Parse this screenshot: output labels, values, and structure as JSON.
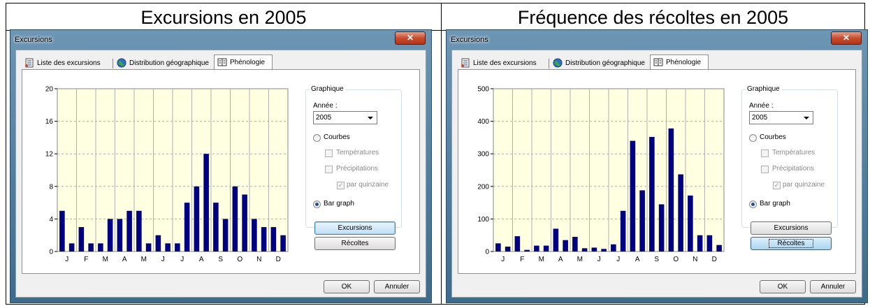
{
  "panels": [
    {
      "heading": "Excursions en 2005",
      "window_title": "Excursions",
      "tabs": [
        {
          "label": "Liste des excursions",
          "icon": "list-icon",
          "active": false
        },
        {
          "label": "Distribution géographique",
          "icon": "globe-icon",
          "active": false
        },
        {
          "label": "Phénologie",
          "icon": "book-icon",
          "active": true
        }
      ],
      "group_title": "Graphique",
      "annee_label": "Année :",
      "annee_value": "2005",
      "radio_courbes": "Courbes",
      "chk_temperatures": "Températures",
      "chk_precipitations": "Précipitations",
      "chk_quinzaine": "par quinzaine",
      "radio_bargraph": "Bar graph",
      "btn_excursions": "Excursions",
      "btn_recoltes": "Récoltes",
      "ok_label": "OK",
      "cancel_label": "Annuler",
      "chart_data": {
        "type": "bar",
        "title": "",
        "xlabel": "",
        "ylabel": "",
        "ylim": [
          0,
          20
        ],
        "yticks": [
          0,
          4,
          8,
          12,
          16,
          20
        ],
        "month_labels": [
          "J",
          "F",
          "M",
          "A",
          "M",
          "J",
          "J",
          "A",
          "S",
          "O",
          "N",
          "D"
        ],
        "categories": [
          "J1",
          "J2",
          "F1",
          "F2",
          "M1",
          "M2",
          "A1",
          "A2",
          "M1",
          "M2",
          "J1",
          "J2",
          "J1",
          "J2",
          "A1",
          "A2",
          "S1",
          "S2",
          "O1",
          "O2",
          "N1",
          "N2",
          "D1",
          "D2"
        ],
        "series": [
          {
            "values": [
              5,
              1,
              3,
              1,
              1,
              4,
              4,
              5,
              5,
              1,
              2,
              1,
              1,
              6,
              8,
              12,
              6,
              4,
              8,
              7,
              4,
              3,
              3,
              2
            ]
          }
        ],
        "grid": true,
        "background": "#ffffe1",
        "bar_color": "#000080"
      }
    },
    {
      "heading": "Fréquence des récoltes en 2005",
      "window_title": "Excursions",
      "tabs": [
        {
          "label": "Liste des excursions",
          "icon": "list-icon",
          "active": false
        },
        {
          "label": "Distribution géographique",
          "icon": "globe-icon",
          "active": false
        },
        {
          "label": "Phénologie",
          "icon": "book-icon",
          "active": true
        }
      ],
      "group_title": "Graphique",
      "annee_label": "Année :",
      "annee_value": "2005",
      "radio_courbes": "Courbes",
      "chk_temperatures": "Températures",
      "chk_precipitations": "Précipitations",
      "chk_quinzaine": "par quinzaine",
      "radio_bargraph": "Bar graph",
      "btn_excursions": "Excursions",
      "btn_recoltes": "Récoltes",
      "ok_label": "OK",
      "cancel_label": "Annuler",
      "chart_data": {
        "type": "bar",
        "title": "",
        "xlabel": "",
        "ylabel": "",
        "ylim": [
          0,
          500
        ],
        "yticks": [
          0,
          100,
          200,
          300,
          400,
          500
        ],
        "month_labels": [
          "J",
          "F",
          "M",
          "A",
          "M",
          "J",
          "J",
          "A",
          "S",
          "O",
          "N",
          "D"
        ],
        "categories": [
          "J1",
          "J2",
          "F1",
          "F2",
          "M1",
          "M2",
          "A1",
          "A2",
          "M1",
          "M2",
          "J1",
          "J2",
          "J1",
          "J2",
          "A1",
          "A2",
          "S1",
          "S2",
          "O1",
          "O2",
          "N1",
          "N2",
          "D1",
          "D2"
        ],
        "series": [
          {
            "values": [
              25,
              15,
              47,
              5,
              18,
              18,
              70,
              35,
              45,
              10,
              12,
              8,
              22,
              125,
              340,
              188,
              352,
              145,
              378,
              237,
              172,
              50,
              50,
              20
            ]
          }
        ],
        "grid": true,
        "background": "#ffffe1",
        "bar_color": "#000080"
      }
    }
  ]
}
